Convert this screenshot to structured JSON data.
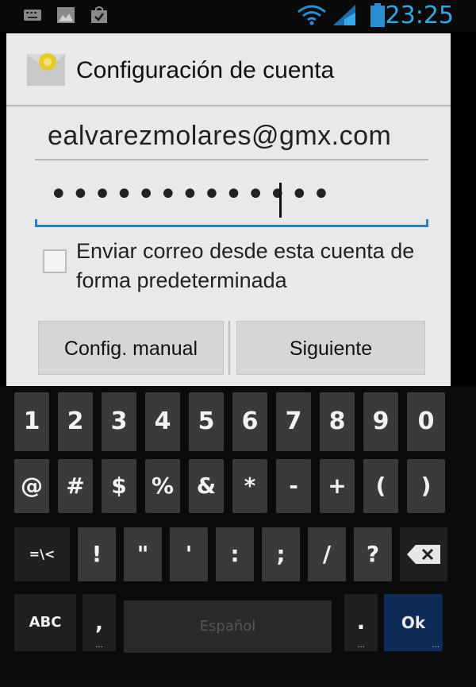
{
  "status_bar": {
    "time": "23:25",
    "icons": [
      "keyboard-icon",
      "image-icon",
      "shopping-bag-icon",
      "wifi-icon",
      "signal-icon",
      "battery-icon"
    ],
    "accent_color": "#35a6e0"
  },
  "dialog": {
    "title": "Configuración de cuenta",
    "email_value": "ealvarezmolares@gmx.com",
    "password_value": "•••••••••••••",
    "checkbox_label": "Enviar correo desde esta cuenta de forma predeterminada",
    "checkbox_checked": false,
    "manual_button": "Config. manual",
    "next_button": "Siguiente"
  },
  "keyboard": {
    "row1": [
      "1",
      "2",
      "3",
      "4",
      "5",
      "6",
      "7",
      "8",
      "9",
      "0"
    ],
    "row2": [
      "@",
      "#",
      "$",
      "%",
      "&",
      "*",
      "-",
      "+",
      "(",
      ")"
    ],
    "row3": [
      "=\\<",
      "!",
      "\"",
      "'",
      ":",
      ";",
      "/",
      "?"
    ],
    "backspace_icon": "backspace-icon",
    "abc_label": "ABC",
    "comma_label": ",",
    "space_label": "Español",
    "period_label": ".",
    "ok_label": "Ok",
    "ok_color": "#0e2a57"
  }
}
